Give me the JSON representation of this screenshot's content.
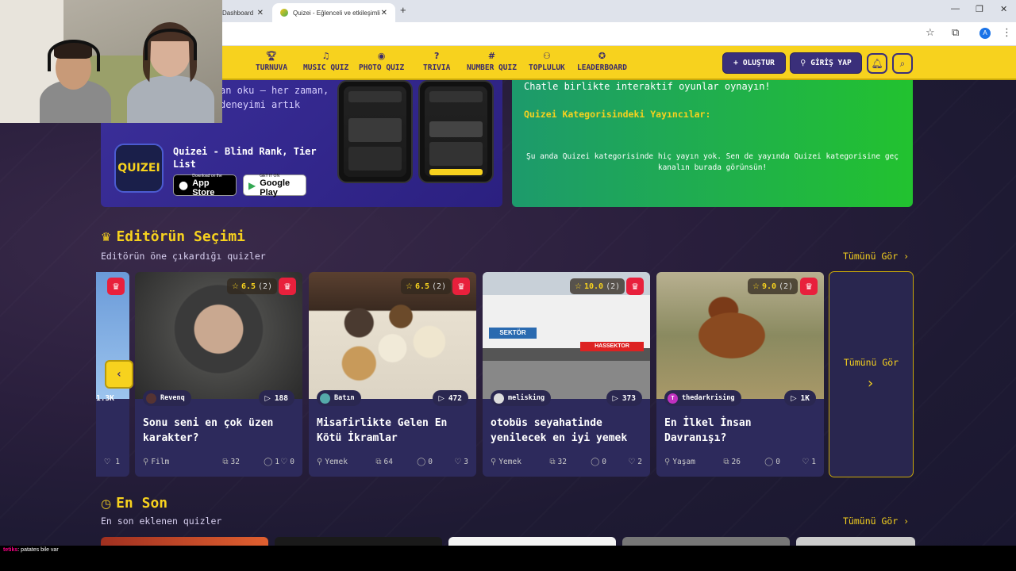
{
  "browser": {
    "tabs": [
      {
        "label": "Dashboard"
      },
      {
        "label": "Quizei - Eğlenceli ve etkileşimli"
      }
    ],
    "profile_initial": "A"
  },
  "navbar": {
    "items": [
      {
        "label": "TURNUVA",
        "icon": "trophy-icon"
      },
      {
        "label": "MUSIC QUIZ",
        "icon": "music-icon"
      },
      {
        "label": "PHOTO QUIZ",
        "icon": "camera-icon"
      },
      {
        "label": "TRIVIA",
        "icon": "question-icon"
      },
      {
        "label": "NUMBER QUIZ",
        "icon": "hash-icon"
      },
      {
        "label": "TOPLULUK",
        "icon": "users-icon"
      },
      {
        "label": "LEADERBOARD",
        "icon": "medal-icon"
      }
    ],
    "create_label": "OLUŞTUR",
    "login_label": "GİRİŞ YAP"
  },
  "promo": {
    "text_line1": "an oku — her zaman,",
    "text_line2": "deneyimi artık",
    "app_name": "Quizei - Blind Rank, Tier List",
    "app_logo_text": "QUIZEI",
    "apple_small": "Download on the",
    "apple_big": "App Store",
    "google_small": "GET IT ON",
    "google_big": "Google Play"
  },
  "streamers": {
    "line1": "Chatle birlikte interaktif oyunlar oynayın!",
    "heading": "Quizei Kategorisindeki Yayıncılar:",
    "empty": "Şu anda Quizei kategorisinde hiç yayın yok. Sen de yayında Quizei kategorisine geç kanalın burada görünsün!"
  },
  "editors": {
    "title": "Editörün Seçimi",
    "subtitle": "Editörün öne çıkardığı quizler",
    "see_all": "Tümünü Gör ›",
    "partial_card": {
      "plays": "1.3K",
      "likes": "1"
    },
    "cards": [
      {
        "rating": "6.5",
        "rating_count": "(2)",
        "author": "Revenq",
        "plays": "188",
        "title": "Sonu seni en çok üzen karakter?",
        "category": "Film",
        "questions": "32",
        "comments": "1",
        "likes": "0"
      },
      {
        "rating": "6.5",
        "rating_count": "(2)",
        "author": "Batın",
        "plays": "472",
        "title": "Misafirlikte Gelen En Kötü İkramlar",
        "category": "Yemek",
        "questions": "64",
        "comments": "0",
        "likes": "3"
      },
      {
        "rating": "10.0",
        "rating_count": "(2)",
        "author": "melisking",
        "plays": "373",
        "title": "otobüs seyahatinde yenilecek en iyi yemek",
        "category": "Yemek",
        "questions": "32",
        "comments": "0",
        "likes": "2"
      },
      {
        "rating": "9.0",
        "rating_count": "(2)",
        "author": "thedarkrising",
        "author_initial": "T",
        "plays": "1K",
        "title": "En İlkel İnsan Davranışı?",
        "category": "Yaşam",
        "questions": "26",
        "comments": "0",
        "likes": "1"
      }
    ],
    "see_all_card": "Tümünü Gör"
  },
  "recent": {
    "title": "En Son",
    "subtitle": "En son eklenen quizler",
    "see_all": "Tümünü Gör ›"
  },
  "chat": {
    "user": "tetiks",
    "message": ": patates bile var"
  },
  "colors": {
    "accent": "#f7d21e",
    "nav_dark": "#3a2f7a",
    "badge_red": "#e8203c"
  }
}
